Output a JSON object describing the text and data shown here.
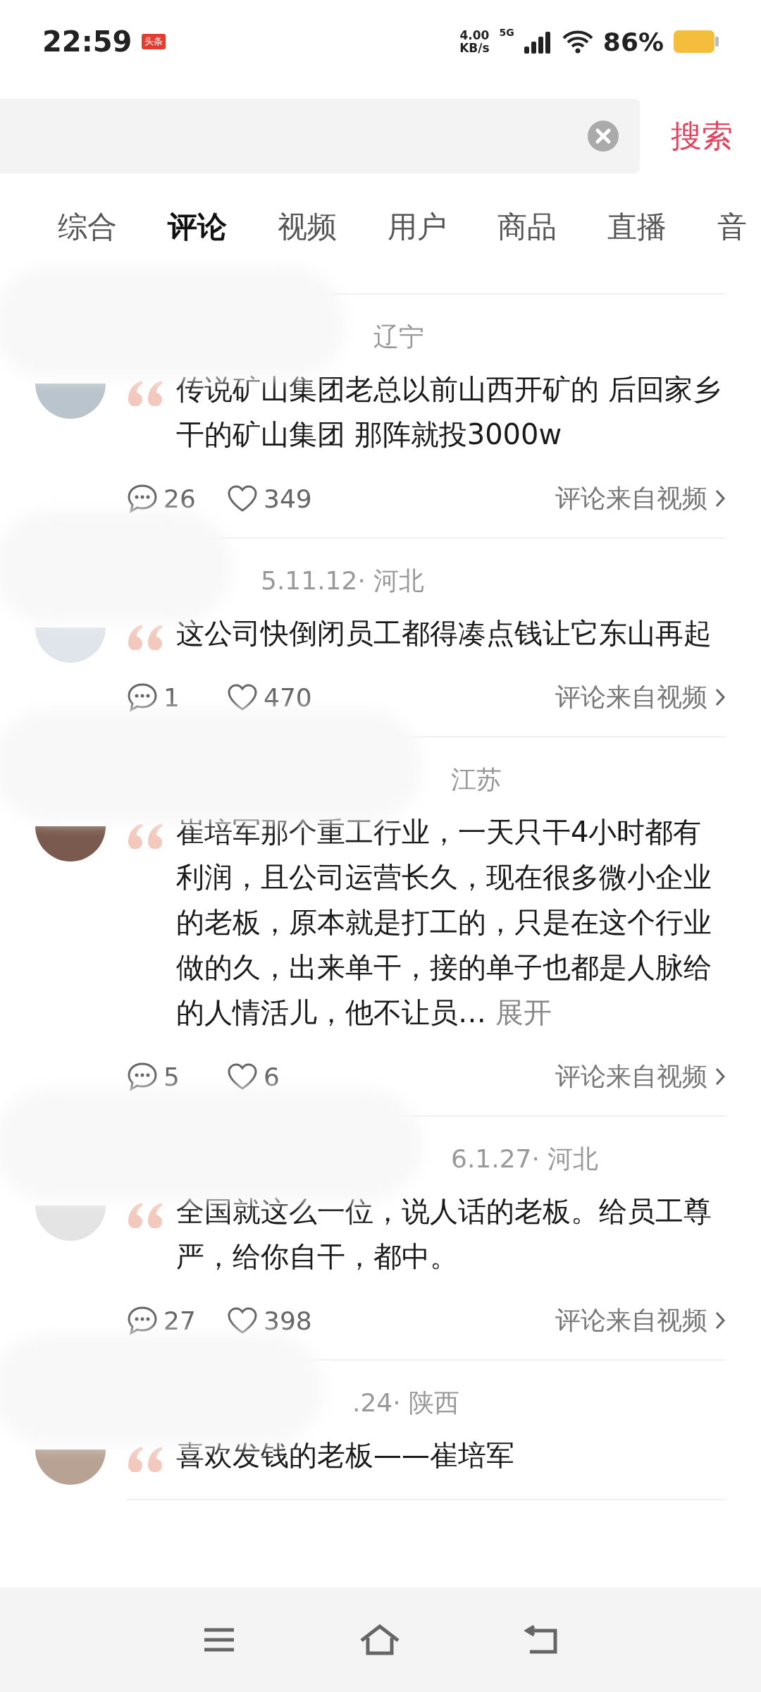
{
  "status_bar": {
    "time": "22:59",
    "app_badge": "头条",
    "net_speed": "4.00",
    "net_unit": "KB/s",
    "network": "5G",
    "battery": "86%"
  },
  "search": {
    "button": "搜索"
  },
  "tabs": [
    {
      "label": "综合",
      "selected": false
    },
    {
      "label": "评论",
      "selected": true
    },
    {
      "label": "视频",
      "selected": false
    },
    {
      "label": "用户",
      "selected": false
    },
    {
      "label": "商品",
      "selected": false
    },
    {
      "label": "直播",
      "selected": false
    },
    {
      "label": "音",
      "selected": false
    }
  ],
  "comments": [
    {
      "meta": "辽宁",
      "text": "传说矿山集团老总以前山西开矿的 后回家乡干的矿山集团 那阵就投3000w",
      "replies": "26",
      "likes": "349",
      "source": "评论来自视频"
    },
    {
      "meta": "5.11.12· 河北",
      "text": "这公司快倒闭员工都得凑点钱让它东山再起",
      "replies": "1",
      "likes": "470",
      "source": "评论来自视频"
    },
    {
      "meta": "江苏",
      "text": "崔培军那个重工行业，一天只干4小时都有利润，且公司运营长久，现在很多微小企业的老板，原本就是打工的，只是在这个行业做的久，出来单干，接的单子也都是人脉给的人情活儿，他不让员…",
      "expand": "展开",
      "replies": "5",
      "likes": "6",
      "source": "评论来自视频"
    },
    {
      "meta": "6.1.27· 河北",
      "text": "全国就这么一位，说人话的老板。给员工尊严，给你自干，都中。",
      "replies": "27",
      "likes": "398",
      "source": "评论来自视频"
    },
    {
      "meta": ".24· 陕西",
      "text": "喜欢发钱的老板——崔培军"
    }
  ]
}
